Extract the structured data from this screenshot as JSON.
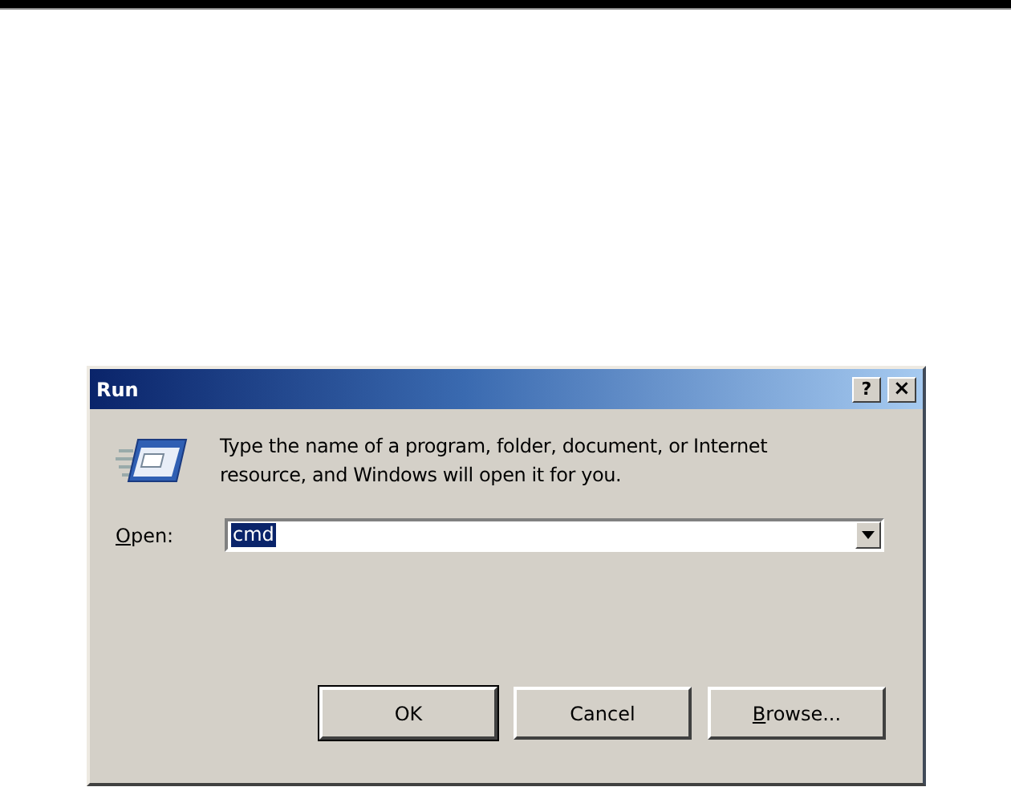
{
  "window": {
    "title": "Run",
    "title_buttons": [
      {
        "kind": "help",
        "label": "?"
      },
      {
        "kind": "close",
        "label": "×"
      }
    ]
  },
  "description": "Type the name of a program, folder, document, or Internet resource, and Windows will open it for you.",
  "open_field": {
    "label": "Open:",
    "label_access_key_underlined": true,
    "value": "cmd",
    "value_selected": true
  },
  "buttons": [
    {
      "label": "OK",
      "default": true,
      "access_key_underlined": false
    },
    {
      "label": "Cancel",
      "default": false,
      "access_key_underlined": false
    },
    {
      "label": "Browse...",
      "default": false,
      "access_key_underlined": true
    }
  ]
}
